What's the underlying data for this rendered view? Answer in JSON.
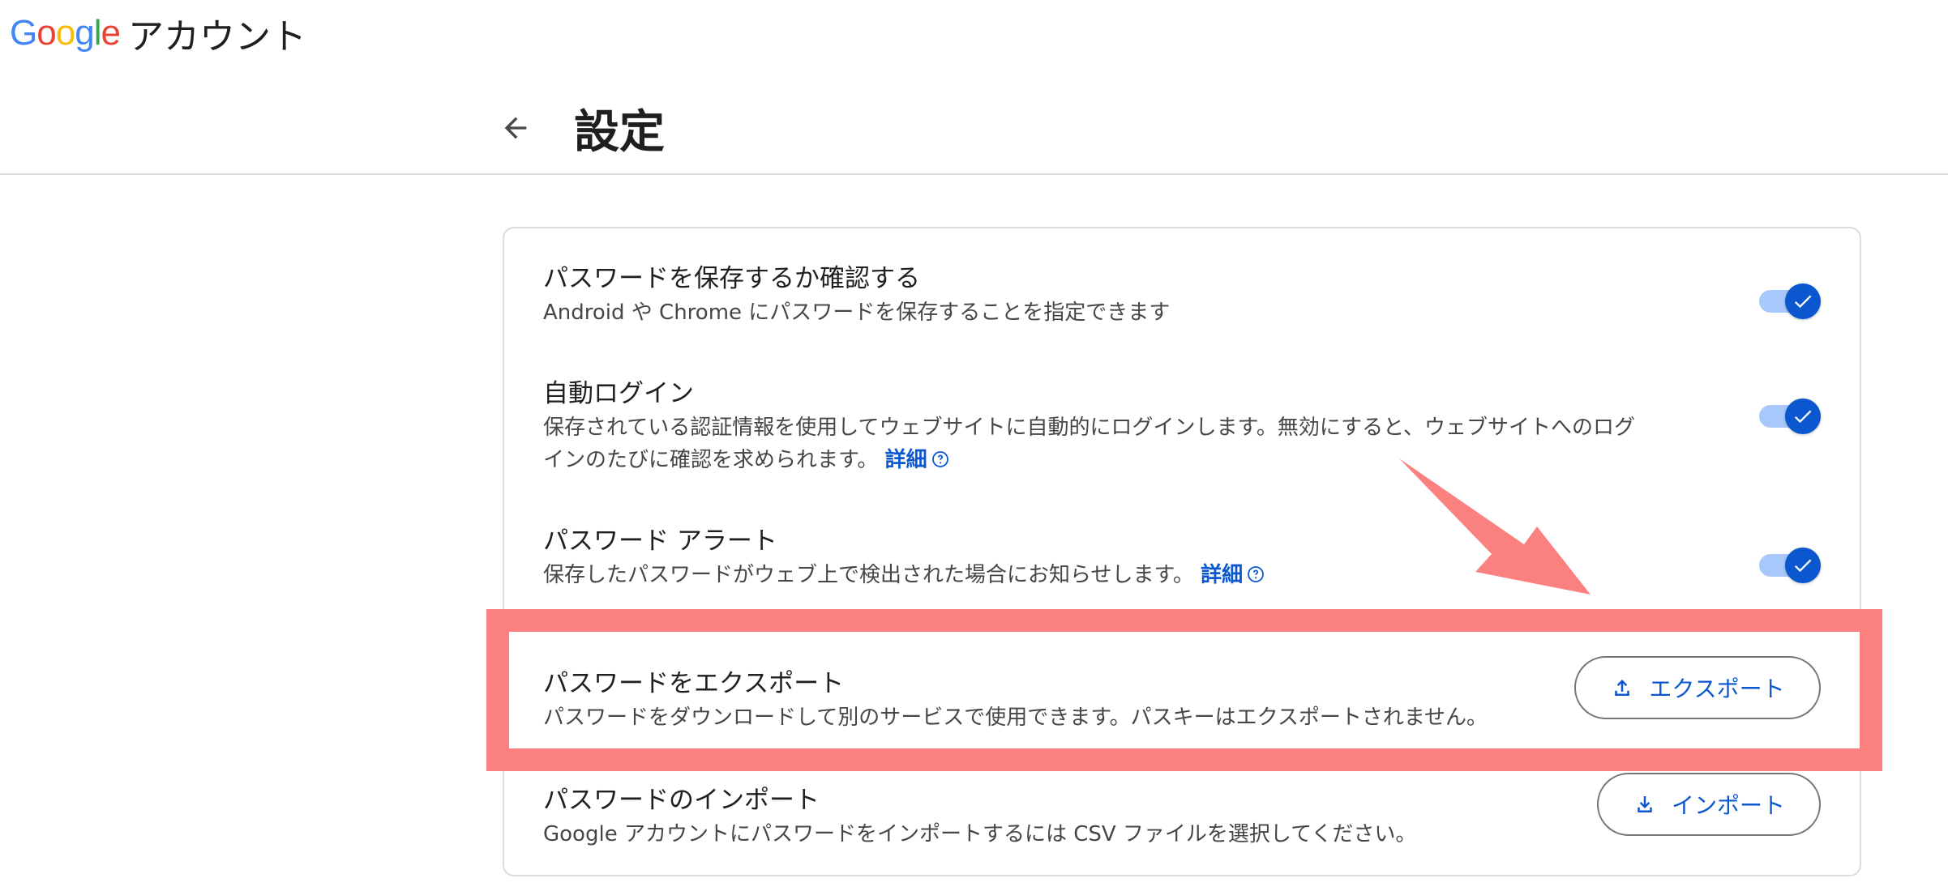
{
  "header": {
    "logo_letters": [
      "G",
      "o",
      "o",
      "g",
      "l",
      "e"
    ],
    "product_name": "アカウント"
  },
  "page": {
    "title": "設定"
  },
  "settings": [
    {
      "title": "パスワードを保存するか確認する",
      "description": "Android や Chrome にパスワードを保存することを指定できます",
      "control": "toggle",
      "enabled": true
    },
    {
      "title": "自動ログイン",
      "description_line1": "保存されている認証情報を使用してウェブサイトに自動的にログインします。無効にすると、ウェブサイトへのログ",
      "description_line2": "インのたびに確認を求められます。",
      "link": "詳細",
      "control": "toggle",
      "enabled": true
    },
    {
      "title": "パスワード アラート",
      "description": "保存したパスワードがウェブ上で検出された場合にお知らせします。",
      "link": "詳細",
      "control": "toggle",
      "enabled": true
    },
    {
      "title": "パスワードをエクスポート",
      "description": "パスワードをダウンロードして別のサービスで使用できます。パスキーはエクスポートされません。",
      "button_label": "エクスポート",
      "button_icon": "upload-icon"
    },
    {
      "title": "パスワードのインポート",
      "description": "Google アカウントにパスワードをインポートするには CSV ファイルを選択してください。",
      "button_label": "インポート",
      "button_icon": "download-icon"
    }
  ],
  "colors": {
    "accent": "#0b57d0",
    "toggle_track": "#a8c7fa",
    "annotation": "#fb8080",
    "google_blue": "#4285f4",
    "google_red": "#ea4335",
    "google_yellow": "#fbbc05",
    "google_green": "#34a853"
  }
}
